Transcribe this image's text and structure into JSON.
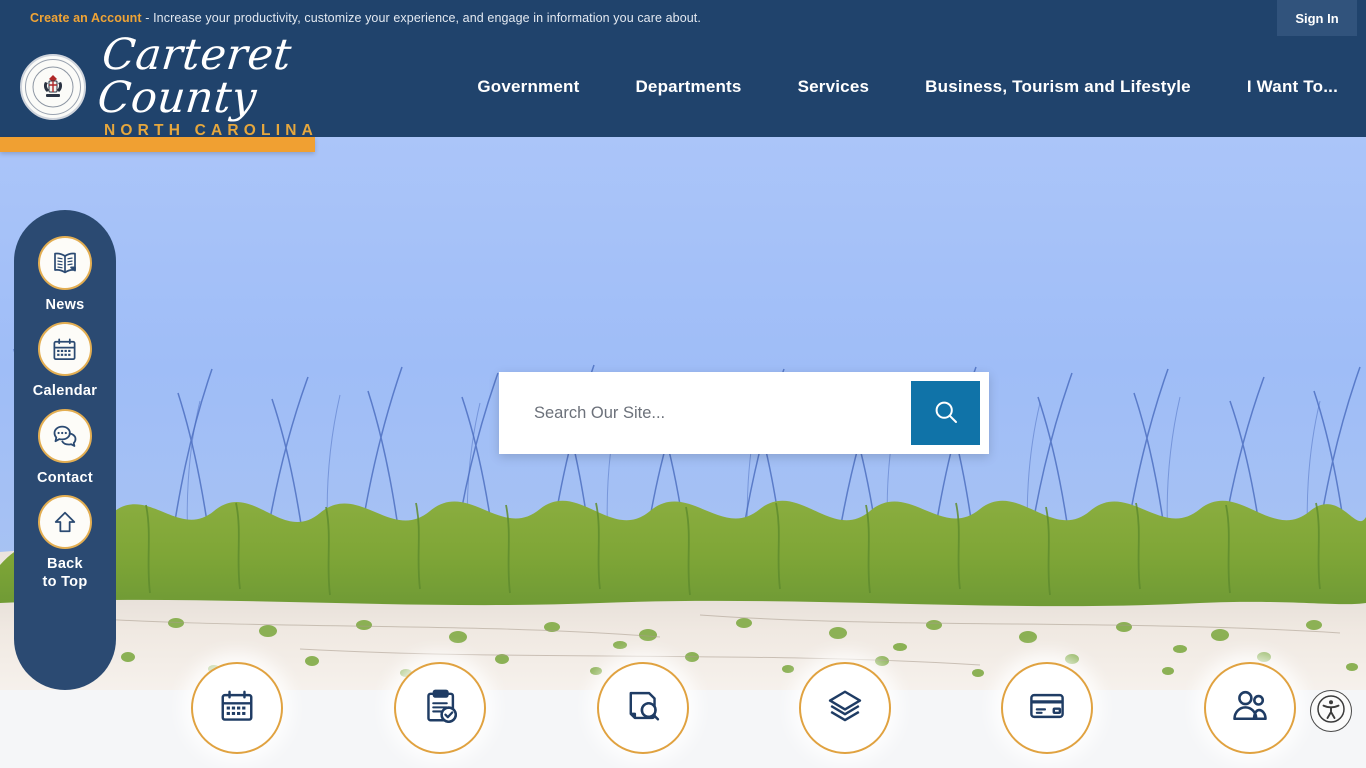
{
  "topbar": {
    "create_account_link": "Create an Account",
    "message": " - Increase your productivity, customize your experience, and engage in information you care about.",
    "signin_label": "Sign In"
  },
  "header": {
    "logo_script": "Carteret County",
    "logo_sub": "NORTH CAROLINA",
    "seal_outer_text": "CARTERET COUNTY · NORTH CAROLINA",
    "nav": [
      {
        "label": "Government",
        "name": "nav-government"
      },
      {
        "label": "Departments",
        "name": "nav-departments"
      },
      {
        "label": "Services",
        "name": "nav-services"
      },
      {
        "label": "Business, Tourism and Lifestyle",
        "name": "nav-business-tourism-lifestyle"
      },
      {
        "label": "I Want To...",
        "name": "nav-i-want-to"
      }
    ],
    "accent_color": "#f0a032",
    "brand_color": "#20436c"
  },
  "sidebar": {
    "items": [
      {
        "label": "News",
        "icon": "news-icon"
      },
      {
        "label": "Calendar",
        "icon": "calendar-icon"
      },
      {
        "label": "Contact",
        "icon": "chat-bubbles-icon"
      },
      {
        "label": "Back\nto Top",
        "label_line1": "Back",
        "label_line2": "to Top",
        "icon": "arrow-up-icon"
      }
    ],
    "background_color": "#2b4a72",
    "circle_border_color": "#e3ae52"
  },
  "search": {
    "placeholder": "Search Our Site...",
    "value": "",
    "button_icon": "search-icon",
    "button_color": "#1073a8"
  },
  "quicklinks": [
    {
      "icon": "calendar-icon",
      "name": "quicklink-calendar"
    },
    {
      "icon": "clipboard-check-icon",
      "name": "quicklink-permits"
    },
    {
      "icon": "document-search-icon",
      "name": "quicklink-records-search"
    },
    {
      "icon": "layers-icon",
      "name": "quicklink-gis-maps"
    },
    {
      "icon": "credit-card-icon",
      "name": "quicklink-pay-online"
    },
    {
      "icon": "people-icon",
      "name": "quicklink-employment"
    }
  ],
  "accessibility": {
    "icon": "accessibility-icon"
  }
}
